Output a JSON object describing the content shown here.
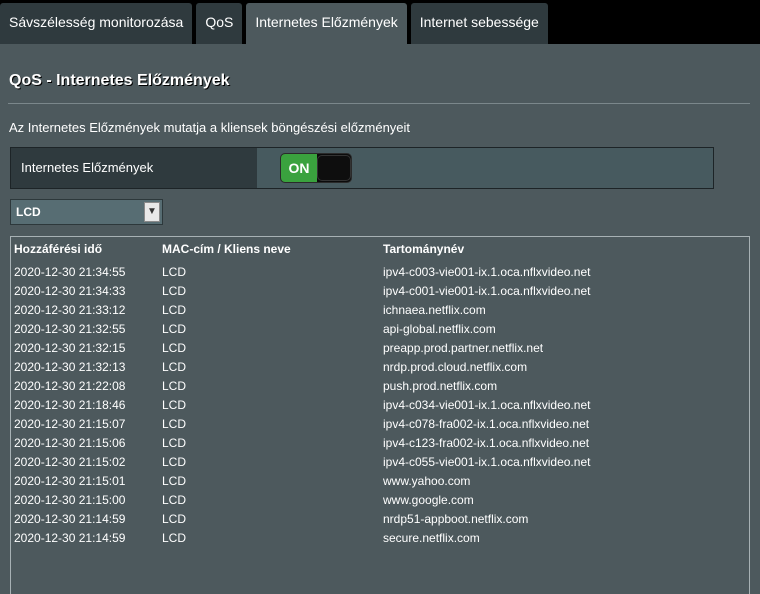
{
  "tabs": [
    {
      "label": "Sávszélesség monitorozása",
      "active": false
    },
    {
      "label": "QoS",
      "active": false
    },
    {
      "label": "Internetes Előzmények",
      "active": true
    },
    {
      "label": "Internet sebessége",
      "active": false
    }
  ],
  "panel": {
    "title": "QoS - Internetes Előzmények",
    "description": "Az Internetes Előzmények mutatja a kliensek böngészési előzményeit"
  },
  "toggle": {
    "label": "Internetes Előzmények",
    "state": "ON"
  },
  "client_select": {
    "value": "LCD"
  },
  "history": {
    "headers": {
      "time": "Hozzáférési idő",
      "client": "MAC-cím / Kliens neve",
      "domain": "Tartománynév"
    },
    "rows": [
      {
        "time": "2020-12-30  21:34:55",
        "client": "LCD",
        "domain": "ipv4-c003-vie001-ix.1.oca.nflxvideo.net"
      },
      {
        "time": "2020-12-30  21:34:33",
        "client": "LCD",
        "domain": "ipv4-c001-vie001-ix.1.oca.nflxvideo.net"
      },
      {
        "time": "2020-12-30  21:33:12",
        "client": "LCD",
        "domain": "ichnaea.netflix.com"
      },
      {
        "time": "2020-12-30  21:32:55",
        "client": "LCD",
        "domain": "api-global.netflix.com"
      },
      {
        "time": "2020-12-30  21:32:15",
        "client": "LCD",
        "domain": "preapp.prod.partner.netflix.net"
      },
      {
        "time": "2020-12-30  21:32:13",
        "client": "LCD",
        "domain": "nrdp.prod.cloud.netflix.com"
      },
      {
        "time": "2020-12-30  21:22:08",
        "client": "LCD",
        "domain": "push.prod.netflix.com"
      },
      {
        "time": "2020-12-30  21:18:46",
        "client": "LCD",
        "domain": "ipv4-c034-vie001-ix.1.oca.nflxvideo.net"
      },
      {
        "time": "2020-12-30  21:15:07",
        "client": "LCD",
        "domain": "ipv4-c078-fra002-ix.1.oca.nflxvideo.net"
      },
      {
        "time": "2020-12-30  21:15:06",
        "client": "LCD",
        "domain": "ipv4-c123-fra002-ix.1.oca.nflxvideo.net"
      },
      {
        "time": "2020-12-30  21:15:02",
        "client": "LCD",
        "domain": "ipv4-c055-vie001-ix.1.oca.nflxvideo.net"
      },
      {
        "time": "2020-12-30  21:15:01",
        "client": "LCD",
        "domain": "www.yahoo.com"
      },
      {
        "time": "2020-12-30  21:15:00",
        "client": "LCD",
        "domain": "www.google.com"
      },
      {
        "time": "2020-12-30  21:14:59",
        "client": "LCD",
        "domain": "nrdp51-appboot.netflix.com"
      },
      {
        "time": "2020-12-30  21:14:59",
        "client": "LCD",
        "domain": "secure.netflix.com"
      }
    ]
  },
  "colors": {
    "background": "#4d595d",
    "tab_inactive": "#2f3a3e",
    "toggle_on": "#3aa23e"
  },
  "icons": {
    "select_arrow": "chevron-down-icon"
  }
}
